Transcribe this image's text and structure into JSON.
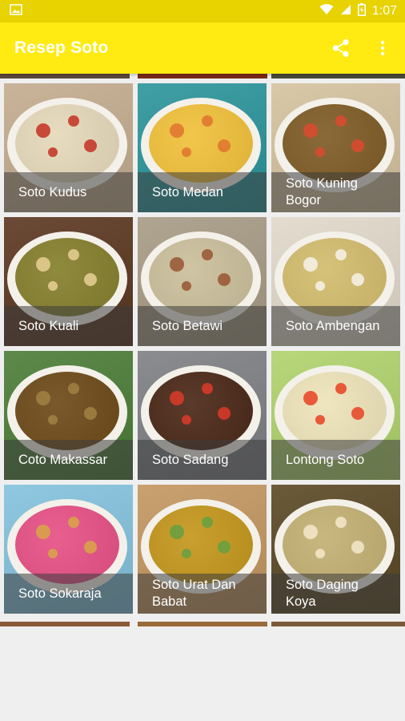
{
  "status": {
    "time": "1:07"
  },
  "app": {
    "title": "Resep Soto"
  },
  "icons": {
    "share": "share-icon",
    "overflow": "overflow-menu-icon",
    "image": "image-icon",
    "wifi": "wifi-icon",
    "signal": "signal-icon",
    "battery": "battery-icon"
  },
  "recipes": [
    {
      "name": "Soto Kudus",
      "bg": "#c9b49a",
      "soup": "#e8dcc0",
      "accent": "#c43a2a"
    },
    {
      "name": "Soto Medan",
      "bg": "#3f9fa5",
      "soup": "#f2c64a",
      "accent": "#e07830"
    },
    {
      "name": "Soto Kuning Bogor",
      "bg": "#d9c8a8",
      "soup": "#8a6a38",
      "accent": "#d84a30"
    },
    {
      "name": "Soto Kuali",
      "bg": "#6b4a36",
      "soup": "#8f8a3e",
      "accent": "#e2cc90"
    },
    {
      "name": "Soto Betawi",
      "bg": "#b0a590",
      "soup": "#cfc4a3",
      "accent": "#9a5a36"
    },
    {
      "name": "Soto Ambengan",
      "bg": "#e3dccf",
      "soup": "#d7c27a",
      "accent": "#f4f0e4"
    },
    {
      "name": "Coto Makassar",
      "bg": "#5d8a4a",
      "soup": "#7a5a2c",
      "accent": "#a08040"
    },
    {
      "name": "Soto Sadang",
      "bg": "#8a8c90",
      "soup": "#5a3a2a",
      "accent": "#d43a2a"
    },
    {
      "name": "Lontong Soto",
      "bg": "#b7d77a",
      "soup": "#efe6c0",
      "accent": "#e84a2a"
    },
    {
      "name": "Soto Sokaraja",
      "bg": "#8fc8e0",
      "soup": "#e85f90",
      "accent": "#d8a24a"
    },
    {
      "name": "Soto Urat Dan Babat",
      "bg": "#c9a070",
      "soup": "#c9a030",
      "accent": "#6aa040"
    },
    {
      "name": "Soto Daging Koya",
      "bg": "#6a5a3a",
      "soup": "#c8b880",
      "accent": "#f2e6c8"
    }
  ]
}
